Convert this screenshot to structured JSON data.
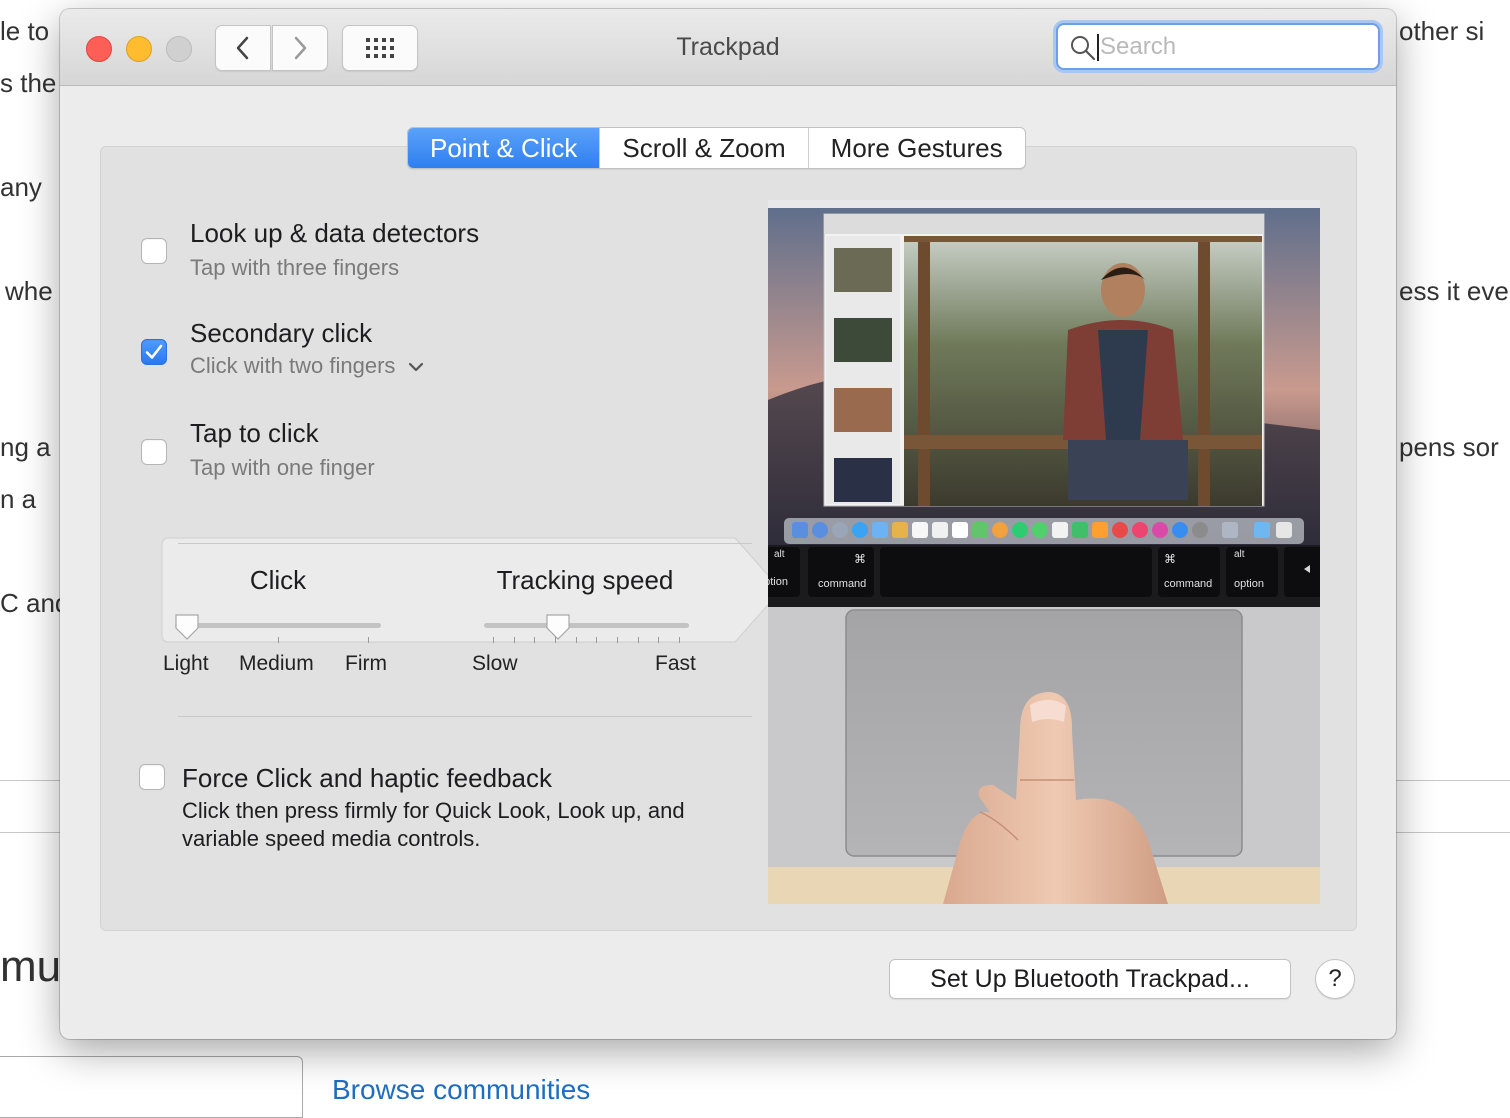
{
  "background": {
    "left_fragments": [
      "le to",
      "s the",
      "any",
      "whe",
      "ng a",
      "n a",
      "C and"
    ],
    "right_fragments": [
      "other si",
      "ess it eve",
      "pens sor"
    ],
    "big_fragment": "mu",
    "link": "Browse communities"
  },
  "window": {
    "title": "Trackpad",
    "search_placeholder": "Search"
  },
  "tabs": [
    {
      "label": "Point & Click",
      "active": true
    },
    {
      "label": "Scroll & Zoom",
      "active": false
    },
    {
      "label": "More Gestures",
      "active": false
    }
  ],
  "options": {
    "lookup": {
      "title": "Look up & data detectors",
      "subtitle": "Tap with three fingers",
      "checked": false
    },
    "secondary": {
      "title": "Secondary click",
      "subtitle": "Click with two fingers",
      "checked": true
    },
    "tap": {
      "title": "Tap to click",
      "subtitle": "Tap with one finger",
      "checked": false
    }
  },
  "click_slider": {
    "title": "Click",
    "labels": [
      "Light",
      "Medium",
      "Firm"
    ],
    "value_index": 0
  },
  "tracking_slider": {
    "title": "Tracking speed",
    "min_label": "Slow",
    "max_label": "Fast",
    "value_fraction": 0.35
  },
  "force_click": {
    "title": "Force Click and haptic feedback",
    "description": "Click then press firmly for Quick Look, Look up, and variable speed media controls.",
    "checked": false
  },
  "preview": {
    "keys": [
      "option",
      "command",
      "command",
      "option"
    ],
    "key_symbols": [
      "alt",
      "⌘",
      "⌘",
      "alt"
    ]
  },
  "buttons": {
    "bluetooth": "Set Up Bluetooth Trackpad...",
    "help": "?"
  }
}
